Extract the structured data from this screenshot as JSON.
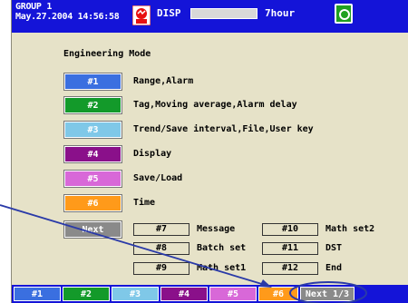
{
  "status": {
    "group": "GROUP 1",
    "datetime": "May.27.2004 14:56:58",
    "disp_label": "DISP",
    "span_label": "7hour"
  },
  "mode_title": "Engineering Mode",
  "menu": [
    {
      "key": "#1",
      "label": "Range,Alarm",
      "color": "#3a6fe0"
    },
    {
      "key": "#2",
      "label": "Tag,Moving average,Alarm delay",
      "color": "#139a2a"
    },
    {
      "key": "#3",
      "label": "Trend/Save interval,File,User key",
      "color": "#7fc8e8"
    },
    {
      "key": "#4",
      "label": "Display",
      "color": "#8a108a"
    },
    {
      "key": "#5",
      "label": "Save/Load",
      "color": "#d868d8"
    },
    {
      "key": "#6",
      "label": "Time",
      "color": "#ff9a1a"
    }
  ],
  "next_key": "Next",
  "next_items": [
    {
      "key": "#7",
      "label": "Message"
    },
    {
      "key": "#8",
      "label": "Batch set"
    },
    {
      "key": "#9",
      "label": "Math set1"
    },
    {
      "key": "#10",
      "label": "Math set2"
    },
    {
      "key": "#11",
      "label": "DST"
    },
    {
      "key": "#12",
      "label": "End"
    }
  ],
  "softkeys": [
    {
      "label": "#1",
      "color": "#3a6fe0"
    },
    {
      "label": "#2",
      "color": "#139a2a"
    },
    {
      "label": "#3",
      "color": "#7fc8e8"
    },
    {
      "label": "#4",
      "color": "#8a108a"
    },
    {
      "label": "#5",
      "color": "#d868d8"
    },
    {
      "label": "#6",
      "color": "#ff9a1a"
    },
    {
      "label": "Next 1/3",
      "color": "#8a8a8a"
    }
  ],
  "colors": {
    "status_bar": "#1414d8",
    "background": "#e6e2c8",
    "pointer": "#2a3aa8"
  },
  "icons": {
    "alarm": "alarm-icon",
    "media": "media-icon"
  }
}
